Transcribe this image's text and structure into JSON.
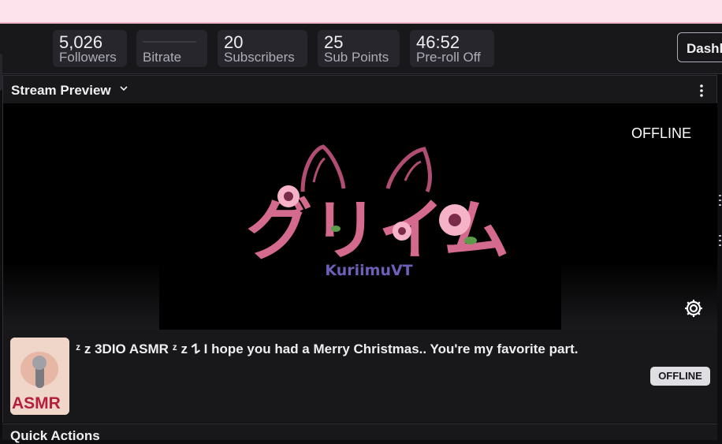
{
  "header": {},
  "stats": [
    {
      "value": "5,026",
      "label": "Followers"
    },
    {
      "value": "",
      "label": "Bitrate"
    },
    {
      "value": "20",
      "label": "Subscribers"
    },
    {
      "value": "25",
      "label": "Sub Points"
    },
    {
      "value": "46:52",
      "label": "Pre-roll Off"
    }
  ],
  "dashboard_button": "Dashb",
  "stream_preview": {
    "title": "Stream Preview",
    "status_overlay": "OFFLINE",
    "logo_text": "KuriimuVT",
    "logo_kana": "グリイム"
  },
  "stream_info": {
    "title": "ᶻ z 3DIO ASMR ᶻ z 𐰁 I hope you had a Merry Christmas.. You're my favorite part.",
    "thumbnail_label": "ASMR",
    "status_badge": "OFFLINE"
  },
  "next_panel": {
    "title": "Quick Actions"
  },
  "colors": {
    "accent_pink": "#c2567a",
    "logo_purple": "#6e5fb8",
    "background": "#0e0e10",
    "panel": "#18181b"
  },
  "icons": [
    "chevron-down-icon",
    "more-vertical-icon",
    "gear-icon"
  ]
}
